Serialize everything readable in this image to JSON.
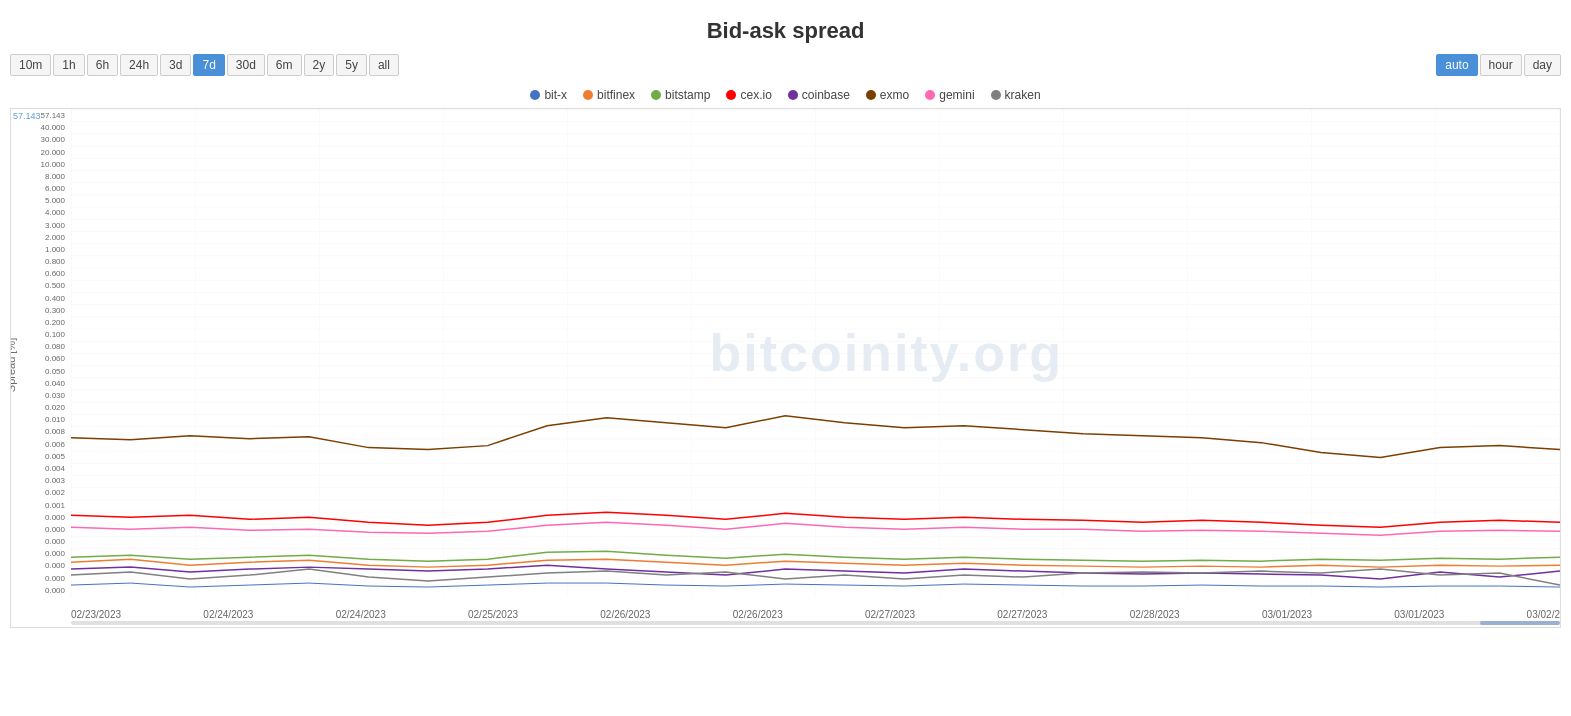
{
  "title": "Bid-ask spread",
  "timeButtons": [
    {
      "label": "10m",
      "active": false
    },
    {
      "label": "1h",
      "active": false
    },
    {
      "label": "6h",
      "active": false
    },
    {
      "label": "24h",
      "active": false
    },
    {
      "label": "3d",
      "active": false
    },
    {
      "label": "7d",
      "active": true
    },
    {
      "label": "30d",
      "active": false
    },
    {
      "label": "6m",
      "active": false
    },
    {
      "label": "2y",
      "active": false
    },
    {
      "label": "5y",
      "active": false
    },
    {
      "label": "all",
      "active": false
    }
  ],
  "resolutionButtons": [
    {
      "label": "auto",
      "active": true
    },
    {
      "label": "hour",
      "active": false
    },
    {
      "label": "day",
      "active": false
    }
  ],
  "legend": [
    {
      "name": "bit-x",
      "color": "#4472c4"
    },
    {
      "name": "bitfinex",
      "color": "#ed7d31"
    },
    {
      "name": "bitstamp",
      "color": "#70ad47"
    },
    {
      "name": "cex.io",
      "color": "#ff0000"
    },
    {
      "name": "coinbase",
      "color": "#7030a0"
    },
    {
      "name": "exmo",
      "color": "#7b3f00"
    },
    {
      "name": "gemini",
      "color": "#ff69b4"
    },
    {
      "name": "kraken",
      "color": "#808080"
    }
  ],
  "yAxisLabels": [
    "57.143",
    "40.000",
    "30.000",
    "20.000",
    "10.000",
    "8.000",
    "6.000",
    "5.000",
    "4.000",
    "3.000",
    "2.000",
    "1.000",
    "0.800",
    "0.600",
    "0.500",
    "0.400",
    "0.300",
    "0.200",
    "0.100",
    "0.080",
    "0.060",
    "0.050",
    "0.040",
    "0.030",
    "0.020",
    "0.010",
    "0.008",
    "0.006",
    "0.005",
    "0.004",
    "0.003",
    "0.002",
    "0.001",
    "0.000",
    "0.000",
    "0.000",
    "0.000",
    "0.000",
    "0.000",
    "0.000"
  ],
  "xAxisLabels": [
    "02/23/2023",
    "02/24/2023",
    "02/24/2023",
    "02/25/2023",
    "02/26/2023",
    "02/26/2023",
    "02/27/2023",
    "02/27/2023",
    "02/28/2023",
    "03/01/2023",
    "03/01/2023",
    "03/02/2"
  ],
  "yAxisTitle": "Spread [%]",
  "watermark": "bitcoinity.org",
  "topRefValue": "57.143",
  "scrollbarColor": "#9ab0d0"
}
